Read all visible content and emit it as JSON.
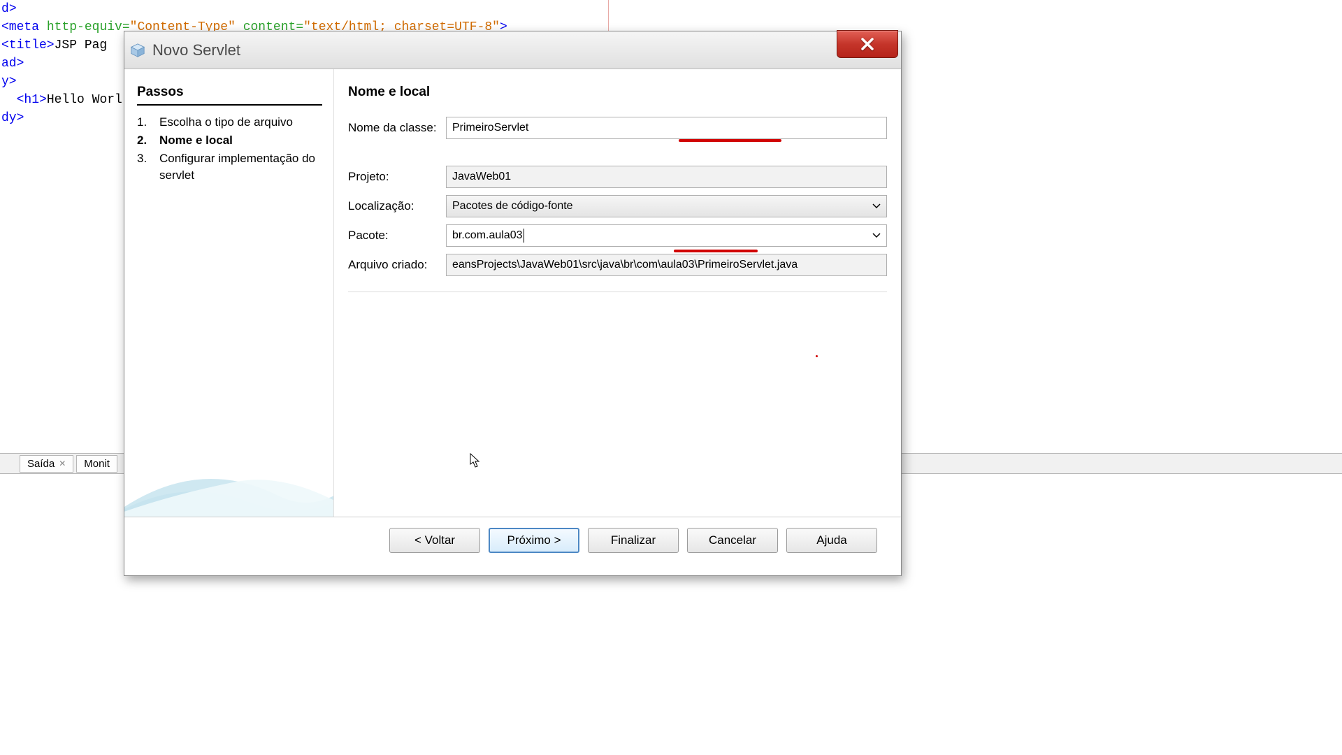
{
  "code_lines": [
    [
      [
        "tag",
        "d"
      ],
      [
        "tag",
        ">"
      ]
    ],
    [
      [
        "tag",
        "<meta"
      ],
      [
        "txt",
        " "
      ],
      [
        "attr",
        "http-equiv="
      ],
      [
        "val",
        "\"Content-Type\""
      ],
      [
        "txt",
        " "
      ],
      [
        "attr",
        "content="
      ],
      [
        "val",
        "\"text/html; charset=UTF-8\""
      ],
      [
        "tag",
        ">"
      ]
    ],
    [
      [
        "tag",
        "<title>"
      ],
      [
        "txt",
        "JSP Pag"
      ]
    ],
    [
      [
        "tag",
        "ad>"
      ]
    ],
    [
      [
        "tag",
        "y>"
      ]
    ],
    [
      [
        "txt",
        "  "
      ],
      [
        "tag",
        "<h1>"
      ],
      [
        "txt",
        "Hello Worl"
      ]
    ],
    [
      [
        "tag",
        "dy>"
      ]
    ]
  ],
  "bottom_tabs": {
    "saida": "Saída",
    "monit": "Monit"
  },
  "dialog": {
    "title": "Novo Servlet",
    "steps_heading": "Passos",
    "steps": [
      {
        "num": "1.",
        "label": "Escolha o tipo de arquivo",
        "current": false
      },
      {
        "num": "2.",
        "label": "Nome e local",
        "current": true
      },
      {
        "num": "3.",
        "label": "Configurar implementação do servlet",
        "current": false
      }
    ],
    "form": {
      "heading": "Nome e local",
      "class_name_label": "Nome da classe:",
      "class_name_value": "PrimeiroServlet",
      "project_label": "Projeto:",
      "project_value": "JavaWeb01",
      "location_label": "Localização:",
      "location_value": "Pacotes de código-fonte",
      "package_label": "Pacote:",
      "package_value": "br.com.aula03",
      "created_label": "Arquivo criado:",
      "created_value": "eansProjects\\JavaWeb01\\src\\java\\br\\com\\aula03\\PrimeiroServlet.java"
    },
    "buttons": {
      "back": "< Voltar",
      "next": "Próximo >",
      "finish": "Finalizar",
      "cancel": "Cancelar",
      "help": "Ajuda"
    }
  }
}
